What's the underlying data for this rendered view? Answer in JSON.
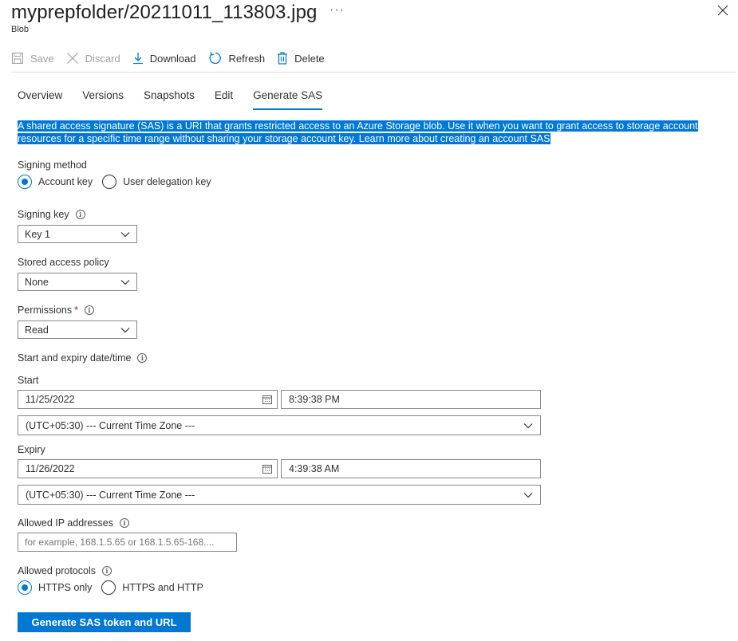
{
  "header": {
    "title": "myprepfolder/20211011_113803.jpg",
    "subtitle": "Blob",
    "more_label": "···"
  },
  "toolbar": {
    "save": "Save",
    "discard": "Discard",
    "download": "Download",
    "refresh": "Refresh",
    "delete": "Delete"
  },
  "tabs": [
    "Overview",
    "Versions",
    "Snapshots",
    "Edit",
    "Generate SAS"
  ],
  "description": "A shared access signature (SAS) is a URI that grants restricted access to an Azure Storage blob. Use it when you want to grant access to storage account resources for a specific time range without sharing your storage account key. Learn more about creating an account SAS",
  "signing_method": {
    "label": "Signing method",
    "options": [
      "Account key",
      "User delegation key"
    ],
    "selected": "Account key"
  },
  "signing_key": {
    "label": "Signing key",
    "value": "Key 1"
  },
  "stored_policy": {
    "label": "Stored access policy",
    "value": "None"
  },
  "permissions": {
    "label": "Permissions",
    "required_mark": "*",
    "value": "Read"
  },
  "datetime": {
    "label": "Start and expiry date/time",
    "start_label": "Start",
    "start_date": "11/25/2022",
    "start_time": "8:39:38 PM",
    "start_tz": "(UTC+05:30) --- Current Time Zone ---",
    "expiry_label": "Expiry",
    "expiry_date": "11/26/2022",
    "expiry_time": "4:39:38 AM",
    "expiry_tz": "(UTC+05:30) --- Current Time Zone ---"
  },
  "allowed_ip": {
    "label": "Allowed IP addresses",
    "placeholder": "for example, 168.1.5.65 or 168.1.5.65-168...."
  },
  "protocols": {
    "label": "Allowed protocols",
    "options": [
      "HTTPS only",
      "HTTPS and HTTP"
    ],
    "selected": "HTTPS only"
  },
  "generate_button": "Generate SAS token and URL",
  "colors": {
    "accent": "#0078d4",
    "highlight": "#0078d7",
    "required": "#a4262c"
  },
  "icons": [
    "save-icon",
    "discard-icon",
    "download-icon",
    "refresh-icon",
    "delete-icon",
    "close-icon",
    "info-icon",
    "calendar-icon",
    "chevron-down-icon"
  ]
}
